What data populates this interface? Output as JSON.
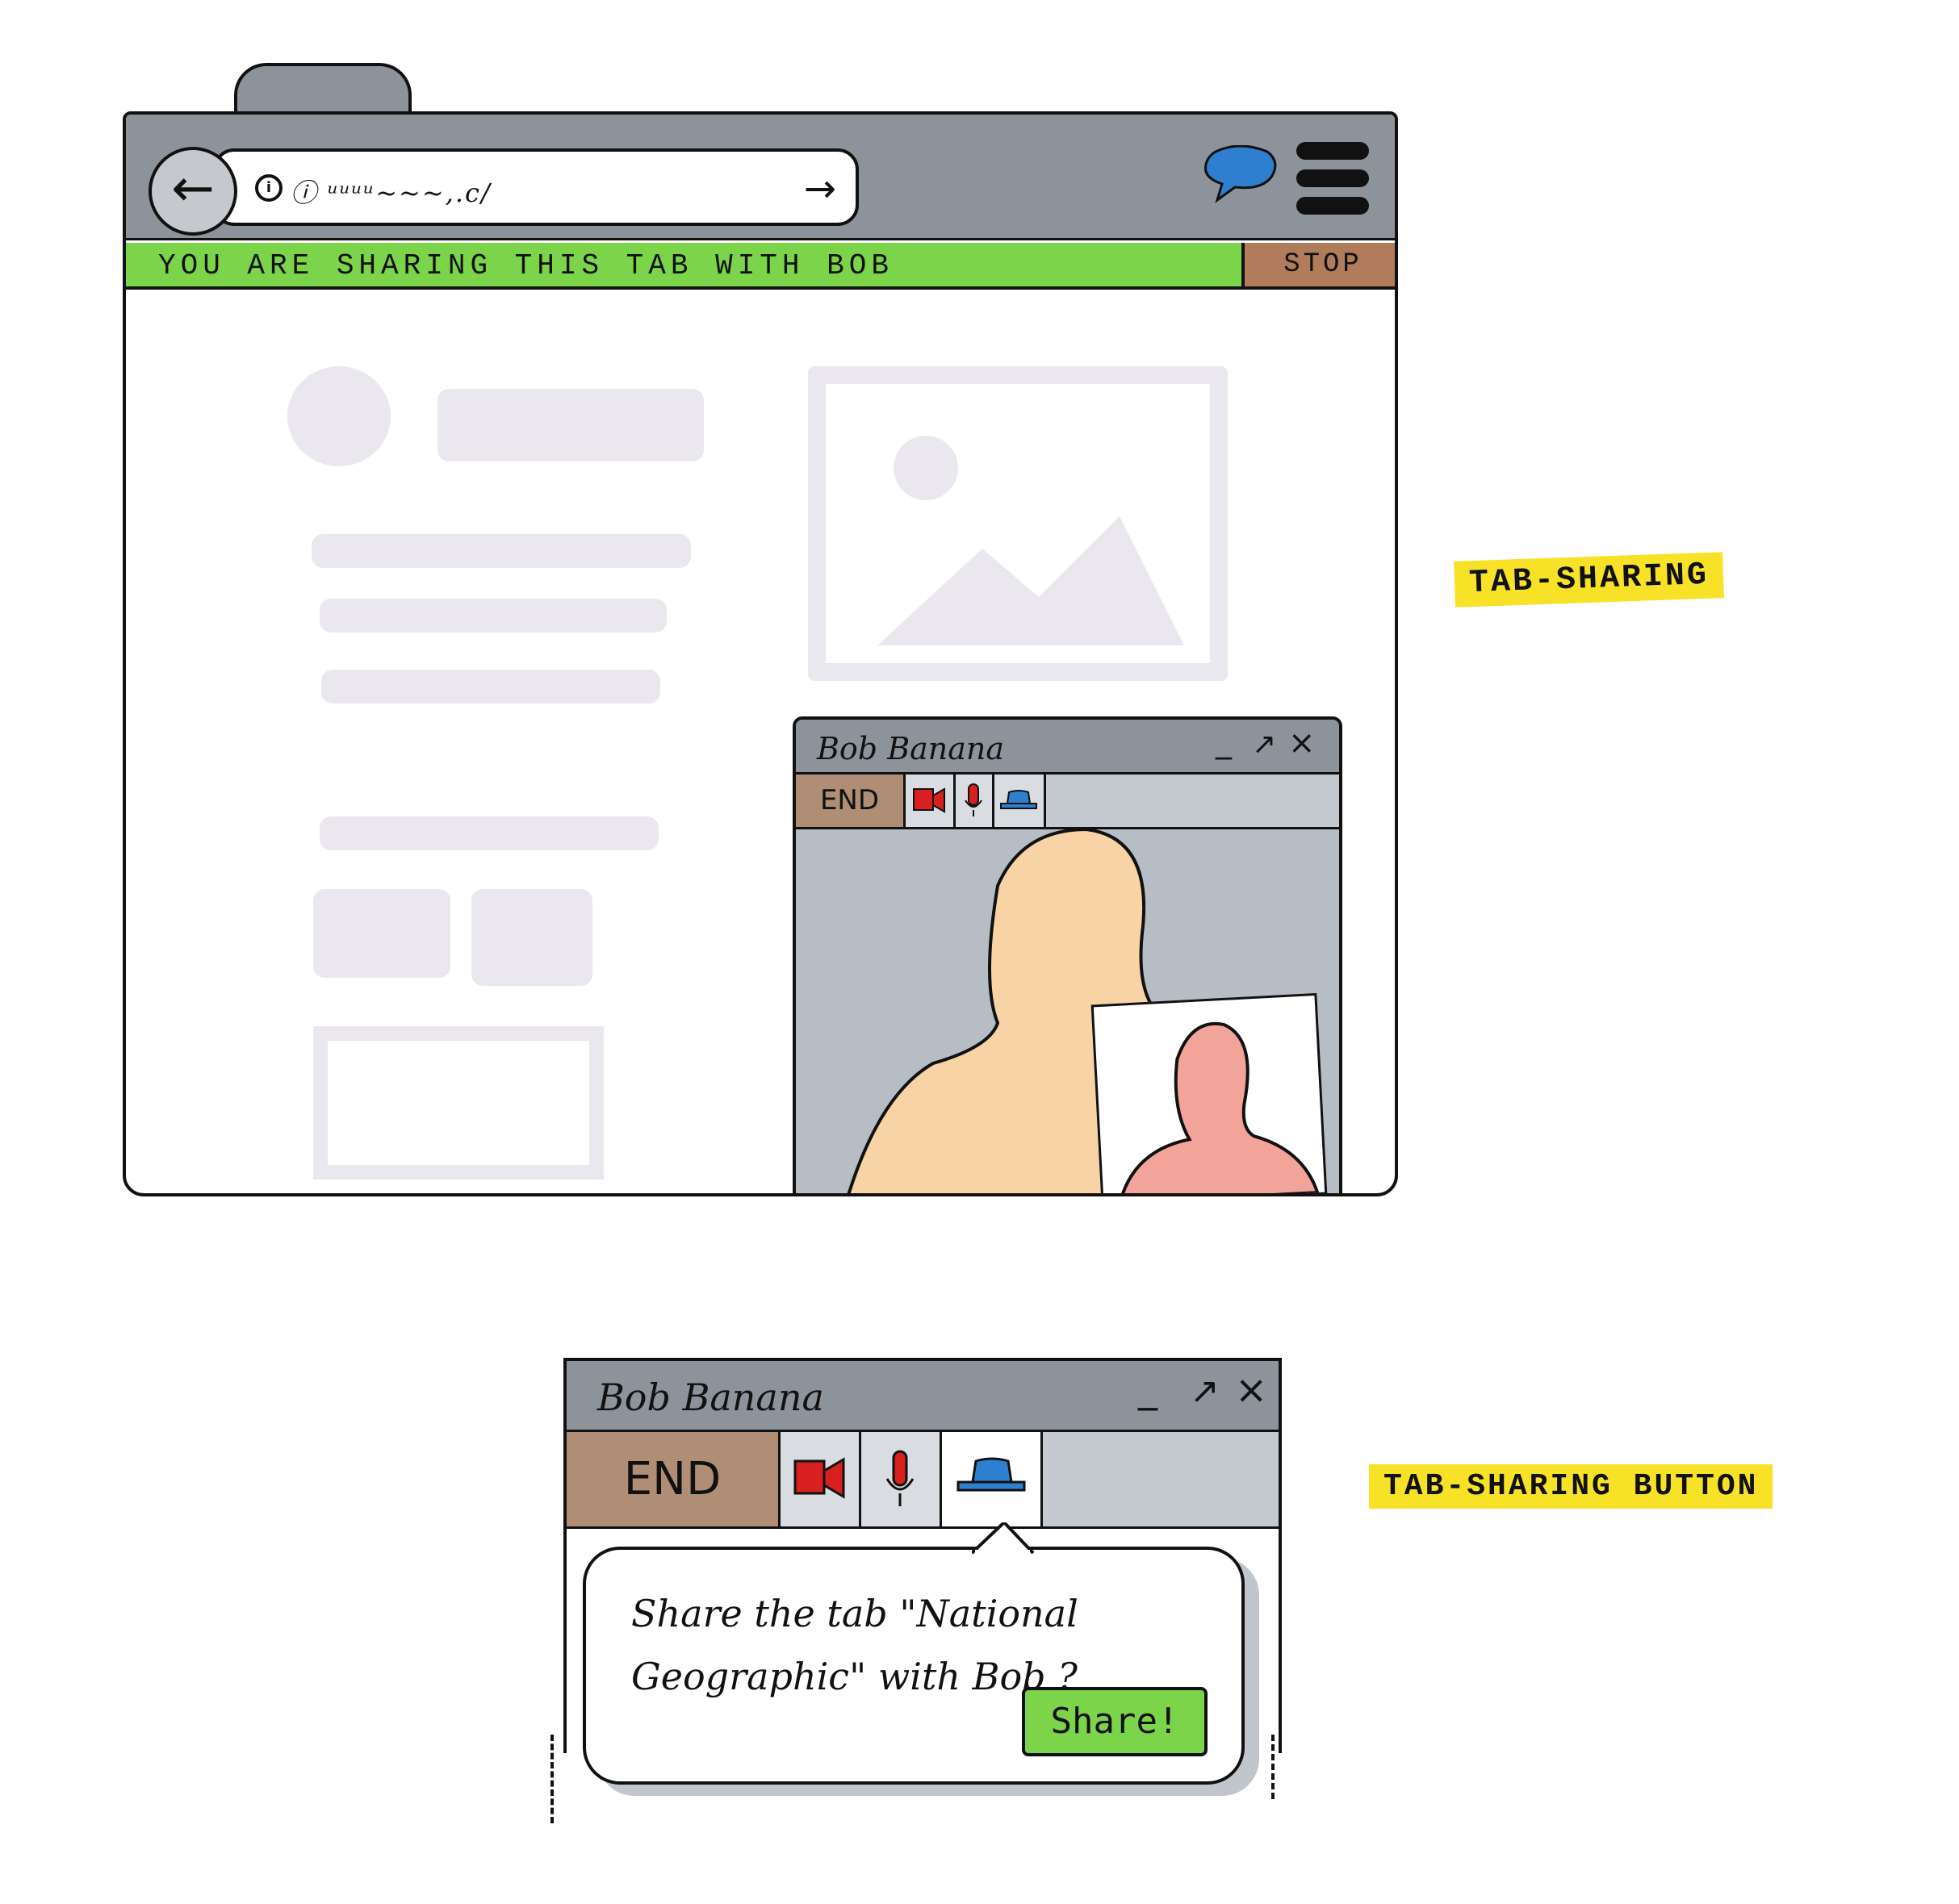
{
  "browser": {
    "back_glyph": "←",
    "url_text": "ⓘ ᵘᵘᵘᵘ~~~,.c/",
    "url_go_glyph": "→",
    "share_banner": "YOU ARE SHARING THIS TAB WITH BOB",
    "stop_label": "STOP",
    "colors": {
      "chrome": "#8d939b",
      "banner": "#7bd44a",
      "stop": "#b07c5c",
      "chat_icon": "#2f7fd0"
    }
  },
  "call_window_small": {
    "contact_name": "Bob Banana",
    "minimize_glyph": "_",
    "popout_glyph": "↗",
    "close_glyph": "×",
    "end_label": "END"
  },
  "call_window_large": {
    "contact_name": "Bob Banana",
    "minimize_glyph": "_",
    "popout_glyph": "↗",
    "close_glyph": "×",
    "end_label": "END",
    "prompt_line1": "Share the tab \"National",
    "prompt_line2": "Geographic\" with Bob ?",
    "share_button": "Share!"
  },
  "annotations": {
    "tab_sharing": "TAB-SHARING",
    "tab_sharing_button": "TAB-SHARING BUTTON"
  },
  "icons": [
    "back-arrow-icon",
    "info-icon",
    "go-arrow-icon",
    "chat-bubble-icon",
    "menu-icon",
    "video-camera-icon",
    "microphone-icon",
    "tab-share-hat-icon"
  ]
}
